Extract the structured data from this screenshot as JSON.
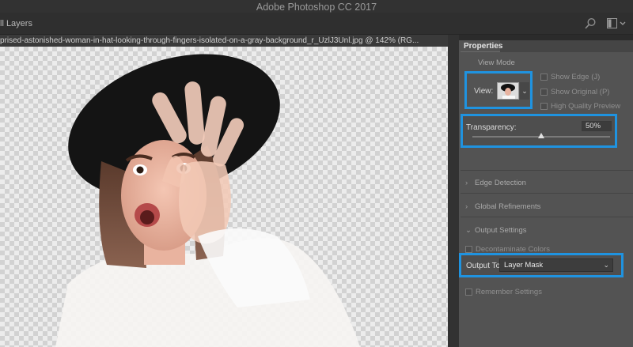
{
  "app": {
    "title": "Adobe Photoshop CC 2017"
  },
  "options_bar": {
    "label": "ll Layers"
  },
  "document": {
    "tab_title": "prised-astonished-woman-in-hat-looking-through-fingers-isolated-on-a-gray-background_r_UzlJ3Unl.jpg @ 142% (RG..."
  },
  "properties": {
    "tab_label": "Properties",
    "view_mode": {
      "heading": "View Mode",
      "view_label": "View:",
      "show_edge": "Show Edge (J)",
      "show_original": "Show Original (P)",
      "high_quality": "High Quality Preview"
    },
    "transparency": {
      "label": "Transparency:",
      "value": "50%",
      "fraction": 0.5
    },
    "sections": {
      "edge_detection": "Edge Detection",
      "global_refinements": "Global Refinements",
      "output_settings": "Output Settings"
    },
    "decontaminate": "Decontaminate Colors",
    "output_to": {
      "label": "Output To:",
      "value": "Layer Mask"
    },
    "remember": "Remember Settings"
  },
  "colors": {
    "highlight": "#1f93e0",
    "panel_bg": "#535353",
    "app_bg": "#2b2b2b"
  },
  "icons": {
    "search": "search-icon",
    "workspace": "workspace-icon"
  }
}
